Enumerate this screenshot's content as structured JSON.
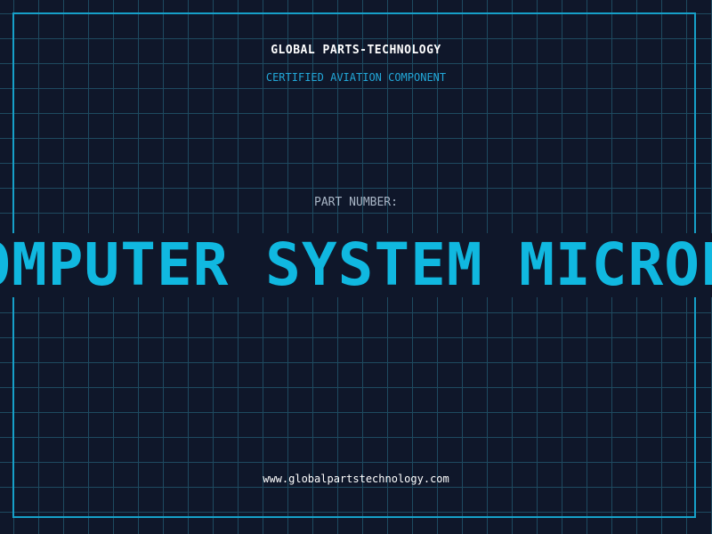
{
  "header": {
    "company": "GLOBAL PARTS-TECHNOLOGY",
    "tagline": "CERTIFIED AVIATION COMPONENT"
  },
  "part": {
    "label": "PART NUMBER:",
    "name": "FLIGHT COMPUTER SYSTEM MICROPROCESSOR"
  },
  "footer": {
    "website": "www.globalpartstechnology.com"
  },
  "colors": {
    "background": "#0f172a",
    "grid": "#1e4a60",
    "frame": "#16a0c8",
    "accent": "#10b8e0",
    "label": "#a9b6c6"
  }
}
